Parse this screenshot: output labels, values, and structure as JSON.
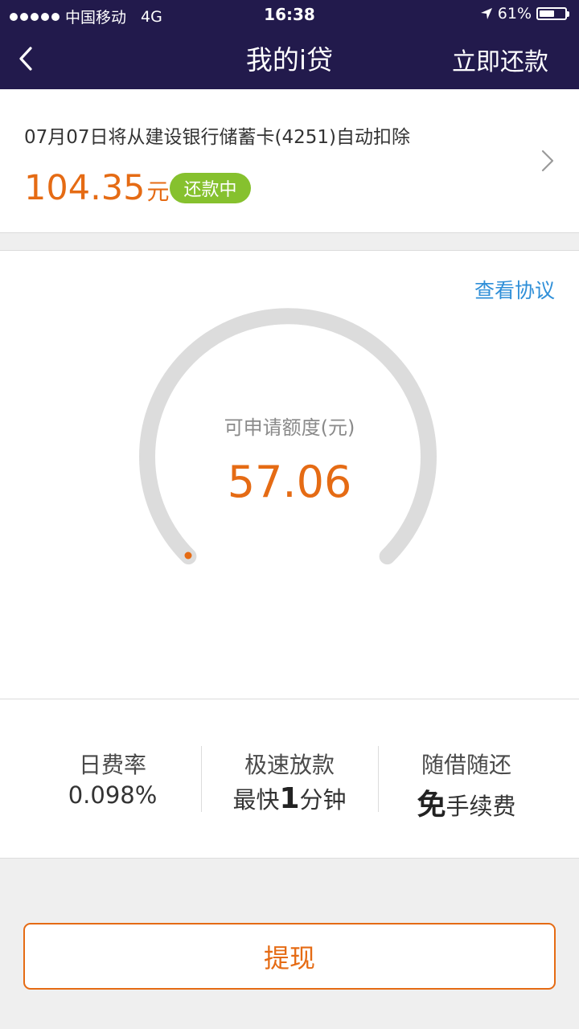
{
  "status_bar": {
    "carrier": "中国移动",
    "network": "4G",
    "time": "16:38",
    "battery": "61%",
    "battery_level": 0.61,
    "location_icon": "location-arrow-icon"
  },
  "nav": {
    "back_icon": "chevron-left-icon",
    "title": "我的i贷",
    "action": "立即还款"
  },
  "repayment": {
    "description": "07月07日将从建设银行储蓄卡(4251)自动扣除",
    "amount": "104.35",
    "unit": "元",
    "status_badge": "还款中",
    "chevron_icon": "chevron-right-icon"
  },
  "credit": {
    "agreement_link": "查看协议",
    "label": "可申请额度(元)",
    "value": "57.06",
    "gauge_fill": 0.0
  },
  "features": [
    {
      "title": "日费率",
      "value": "0.098%"
    },
    {
      "title": "极速放款",
      "prefix": "最快",
      "highlight": "1",
      "suffix": "分钟"
    },
    {
      "title": "随借随还",
      "prefix": "",
      "highlight": "免",
      "suffix": "手续费"
    }
  ],
  "withdraw_button": "提现",
  "colors": {
    "header_bg": "#221a4c",
    "accent_orange": "#e56b14",
    "badge_green": "#86c12e",
    "link_blue": "#2f8fd8",
    "gauge_track": "#dcdcdc"
  }
}
